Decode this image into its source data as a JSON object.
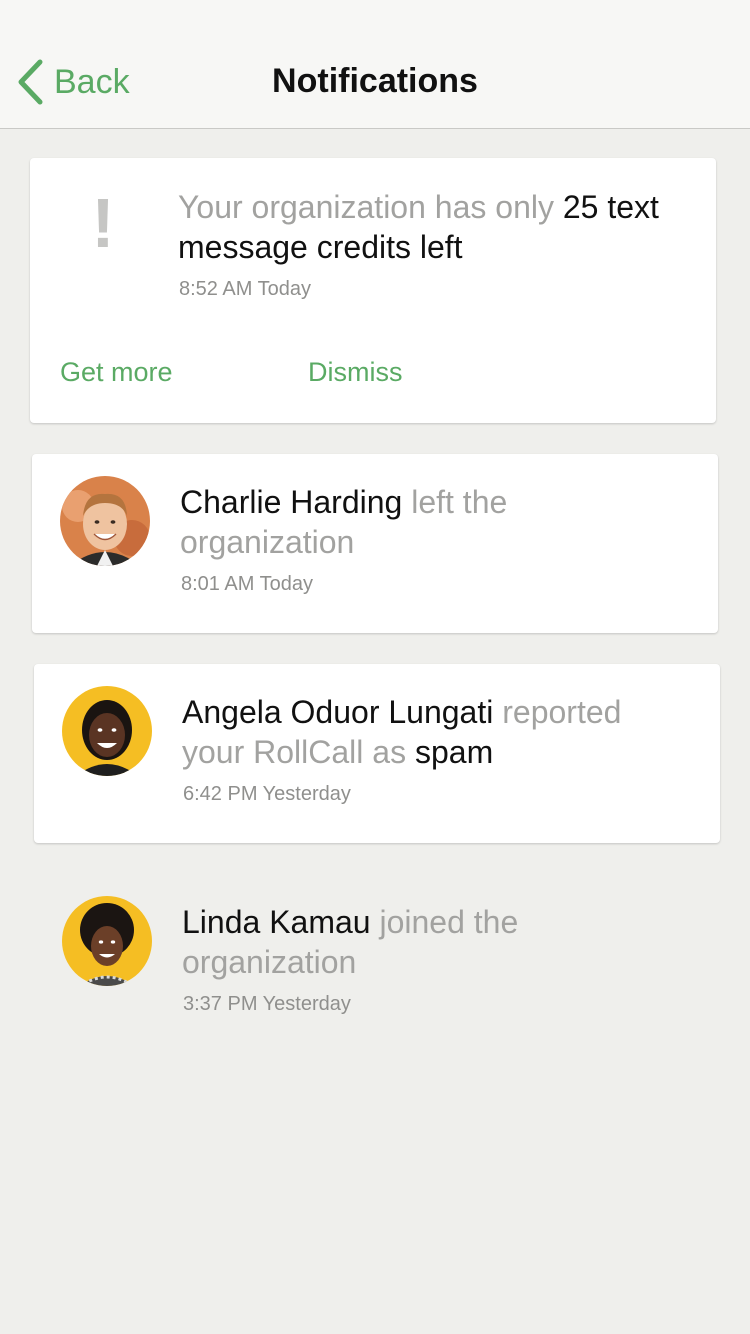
{
  "nav": {
    "back_label": "Back",
    "title": "Notifications"
  },
  "alert": {
    "icon": "exclamation-icon",
    "icon_glyph": "!",
    "text_before": "Your organization has only ",
    "text_strong": "25 text message credits left",
    "time": "8:52 AM Today",
    "actions": {
      "get_more": "Get more",
      "dismiss": "Dismiss"
    }
  },
  "notifications": [
    {
      "name": "Charlie Harding",
      "text": " left the organization",
      "time": "8:01 AM Today",
      "avatar_bg": "#d9824a"
    },
    {
      "name": "Angela Oduor Lungati",
      "text": " reported your RollCall as ",
      "text_strong": "spam",
      "time": "6:42 PM Yesterday",
      "avatar_bg": "#f5be23"
    },
    {
      "name": "Linda Kamau",
      "text": " joined the organization",
      "time": "3:37 PM Yesterday",
      "avatar_bg": "#f5be23"
    }
  ],
  "colors": {
    "accent": "#5aaa64",
    "background": "#efefec",
    "muted_text": "#a2a2a0"
  }
}
